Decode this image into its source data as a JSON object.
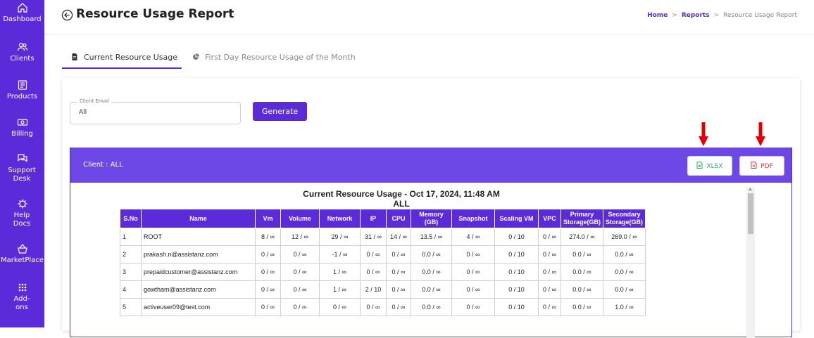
{
  "sidebar": {
    "items": [
      {
        "label": "Dashboard",
        "icon": "home-icon"
      },
      {
        "label": "Clients",
        "icon": "users-icon"
      },
      {
        "label": "Products",
        "icon": "products-icon"
      },
      {
        "label": "Billing",
        "icon": "billing-icon"
      },
      {
        "label": "Support Desk",
        "icon": "support-icon"
      },
      {
        "label": "Help Docs",
        "icon": "help-icon"
      },
      {
        "label": "MarketPlace",
        "icon": "marketplace-icon"
      },
      {
        "label": "Add-ons",
        "icon": "addons-icon"
      }
    ]
  },
  "header": {
    "title": "Resource Usage Report",
    "breadcrumb": {
      "home": "Home",
      "reports": "Reports",
      "current": "Resource Usage Report",
      "separator": ">"
    }
  },
  "tabs": [
    {
      "label": "Current Resource Usage",
      "active": true
    },
    {
      "label": "First Day Resource Usage of the Month",
      "active": false
    }
  ],
  "form": {
    "client_email_label": "Client Email",
    "client_email_value": "All",
    "generate_label": "Generate"
  },
  "panel": {
    "client_label": "Client : ALL",
    "xlsx_label": "XLSX",
    "pdf_label": "PDF"
  },
  "report": {
    "title": "Current Resource Usage - Oct 17, 2024, 11:48 AM",
    "subtitle": "ALL",
    "columns": [
      "S.No",
      "Name",
      "Vm",
      "Volume",
      "Network",
      "IP",
      "CPU",
      "Memory (GB)",
      "Snapshot",
      "Scaling VM",
      "VPC",
      "Primary Storage(GB)",
      "Secondary Storage(GB)"
    ],
    "rows": [
      [
        "1",
        "ROOT",
        "8 / ∞",
        "12 / ∞",
        "29 / ∞",
        "31 / ∞",
        "14 / ∞",
        "13.5 / ∞",
        "4 / ∞",
        "0 / 10",
        "0 / ∞",
        "274.0 / ∞",
        "269.0 / ∞"
      ],
      [
        "2",
        "prakash.n@assistanz.com",
        "0 / ∞",
        "0 / ∞",
        "-1 / ∞",
        "0 / ∞",
        "0 / ∞",
        "0.0 / ∞",
        "0 / ∞",
        "0 / 10",
        "0 / ∞",
        "0.0 / ∞",
        "0.0 / ∞"
      ],
      [
        "3",
        "prepaidcustomer@assistanz.com",
        "0 / ∞",
        "0 / ∞",
        "1 / ∞",
        "0 / ∞",
        "0 / ∞",
        "0.0 / ∞",
        "0 / ∞",
        "0 / 10",
        "0 / ∞",
        "0.0 / ∞",
        "0.0 / ∞"
      ],
      [
        "4",
        "gowtham@assistanz.com",
        "0 / ∞",
        "0 / ∞",
        "1 / ∞",
        "2 / 10",
        "0 / ∞",
        "0.0 / ∞",
        "0 / ∞",
        "0 / 10",
        "0 / ∞",
        "0.0 / ∞",
        "0.0 / ∞"
      ],
      [
        "5",
        "activeuser09@test.com",
        "0 / ∞",
        "0 / ∞",
        "0 / ∞",
        "0 / ∞",
        "0 / ∞",
        "0.0 / ∞",
        "0 / ∞",
        "0 / 10",
        "0 / ∞",
        "0.0 / ∞",
        "1.0 / ∞"
      ]
    ]
  },
  "colors": {
    "primary": "#5b2bd9",
    "panel_header": "#6d48e7",
    "xlsx": "#2eaa5e",
    "pdf": "#e53935",
    "arrow": "#e00000"
  }
}
